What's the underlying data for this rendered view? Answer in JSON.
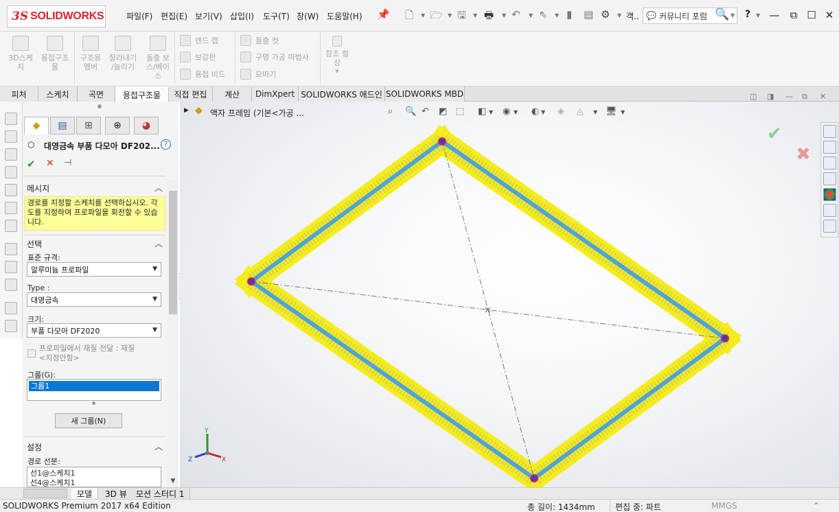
{
  "titlebar": {
    "brand_prefix": "3S",
    "brand": "SOLIDWORKS",
    "menus": [
      "파일(F)",
      "편집(E)",
      "보기(V)",
      "삽입(I)",
      "도구(T)",
      "창(W)",
      "도움말(H)"
    ],
    "overflow": "객..",
    "community": "커뮤니티 포럼",
    "help": "?"
  },
  "commands": {
    "big": [
      "3D스케\n치",
      "용접구조\n물",
      "구조용\n멤버",
      "잘라내기\n/늘리기",
      "돌출 보\n스/베이\n스"
    ],
    "group1": [
      "엔드 캡",
      "보강판",
      "용접 비드"
    ],
    "group2": [
      "돌출 컷",
      "구멍 가공 마법사",
      "모따기"
    ],
    "ref": "참조 형\n상"
  },
  "tabs": [
    "피처",
    "스케치",
    "곡면",
    "용접구조물",
    "직접 편집",
    "계산",
    "DimXpert",
    "SOLIDWORKS 애드인",
    "SOLIDWORKS MBD"
  ],
  "active_tab": "용접구조물",
  "pm": {
    "title": "대영금속 부품 다모아 DF202...",
    "help": "?",
    "message_header": "메시지",
    "message": "경로를 지정할 스케치를 선택하십시오. 각도를 지정하여 프로파일을 회전할 수 있습니다.",
    "selection_header": "선택",
    "standard_label": "표준 규격:",
    "standard_value": "알루미늄 프로파일",
    "type_label": "Type :",
    "type_value": "대영금속",
    "size_label": "크기:",
    "size_value": "부품 다모아 DF2020",
    "transfer_label": "프로파일에서 재질 전달 : 재질\n<지정안함>",
    "group_label": "그룹(G):",
    "group_item": "그룹1",
    "new_group": "새 그룹(N)",
    "settings_header": "설정",
    "path_label": "경로 선분:",
    "path_items": [
      "선1@스케치1",
      "선4@스케치1"
    ]
  },
  "viewport": {
    "tree_item": "액자 프레임  (기본<가공 ..."
  },
  "bottom_tabs": [
    "모델",
    "3D 뷰",
    "모션 스터디 1"
  ],
  "status": {
    "edition": "SOLIDWORKS Premium 2017 x64 Edition",
    "length": "총 길이: 1434mm",
    "editing": "편집 중: 파트",
    "units": "MMGS"
  },
  "colors": {
    "selection_yellow": "#f4ec1c",
    "member_blue": "#4da3dc",
    "accept_green": "#2e9a3a",
    "cancel_red": "#cc2b2b",
    "brand_red": "#d9232d"
  }
}
